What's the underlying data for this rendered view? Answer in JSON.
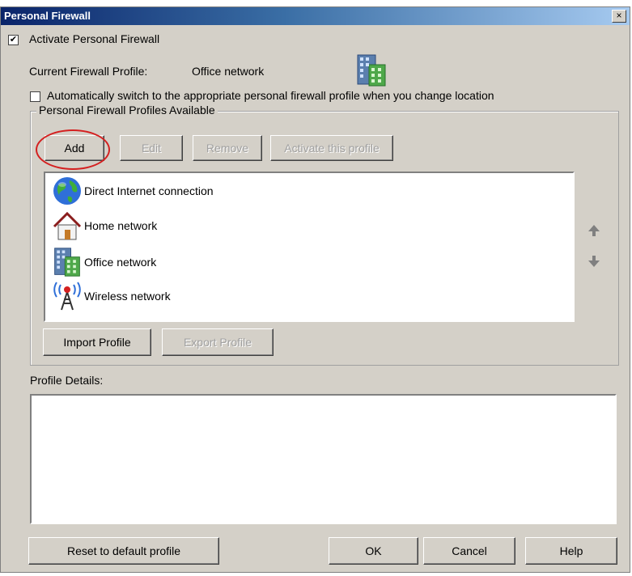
{
  "window": {
    "title": "Personal Firewall",
    "close_label": "×"
  },
  "activate_checkbox": {
    "checked": true,
    "label": "Activate Personal Firewall"
  },
  "current_profile": {
    "label": "Current Firewall Profile:",
    "value": "Office network",
    "icon": "office-building-icon"
  },
  "auto_switch_checkbox": {
    "checked": false,
    "label": "Automatically switch to the appropriate personal firewall profile when you change location"
  },
  "profiles_group": {
    "legend": "Personal Firewall Profiles Available",
    "buttons": {
      "add": "Add",
      "edit": "Edit",
      "remove": "Remove",
      "activate": "Activate this profile"
    },
    "items": [
      {
        "label": "Direct Internet connection",
        "icon": "globe-icon"
      },
      {
        "label": "Home network",
        "icon": "house-icon"
      },
      {
        "label": "Office network",
        "icon": "office-building-icon"
      },
      {
        "label": "Wireless network",
        "icon": "wireless-tower-icon"
      }
    ],
    "import_label": "Import Profile",
    "export_label": "Export Profile"
  },
  "profile_details": {
    "label": "Profile Details:",
    "content": ""
  },
  "footer": {
    "reset_label": "Reset to default profile",
    "ok_label": "OK",
    "cancel_label": "Cancel",
    "help_label": "Help"
  },
  "annotation": {
    "color": "#d42020",
    "target": "Add"
  }
}
